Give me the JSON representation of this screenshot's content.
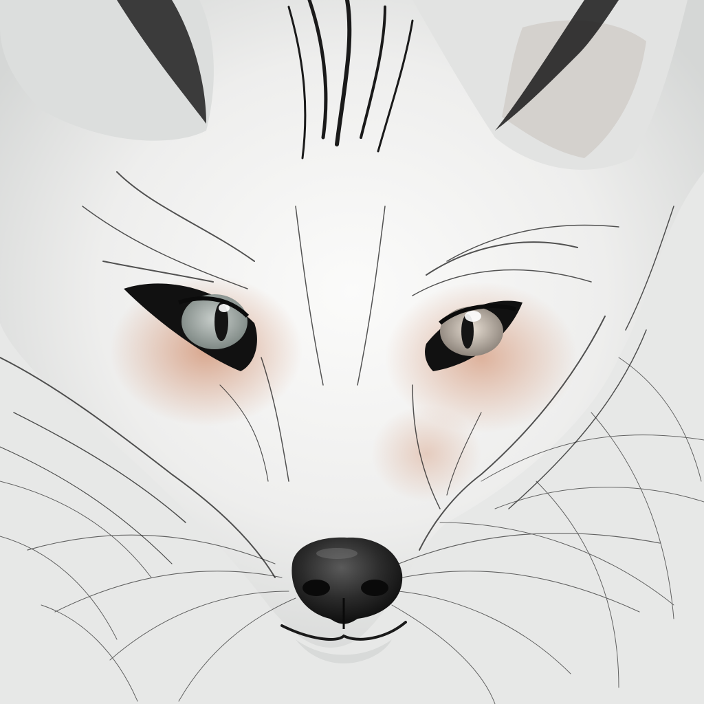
{
  "artwork": {
    "subject_icon": "fox-face-line-drawing",
    "palette": {
      "background": "#e6e7e6",
      "fur_light": "#f4f4f3",
      "fur_shadow": "#b9bcbc",
      "ear_shadow": "#1c1c1c",
      "blush": "#d7a58d",
      "iris": "#9aa39f",
      "nose": "#2a2a2a",
      "line": "#161616"
    }
  }
}
